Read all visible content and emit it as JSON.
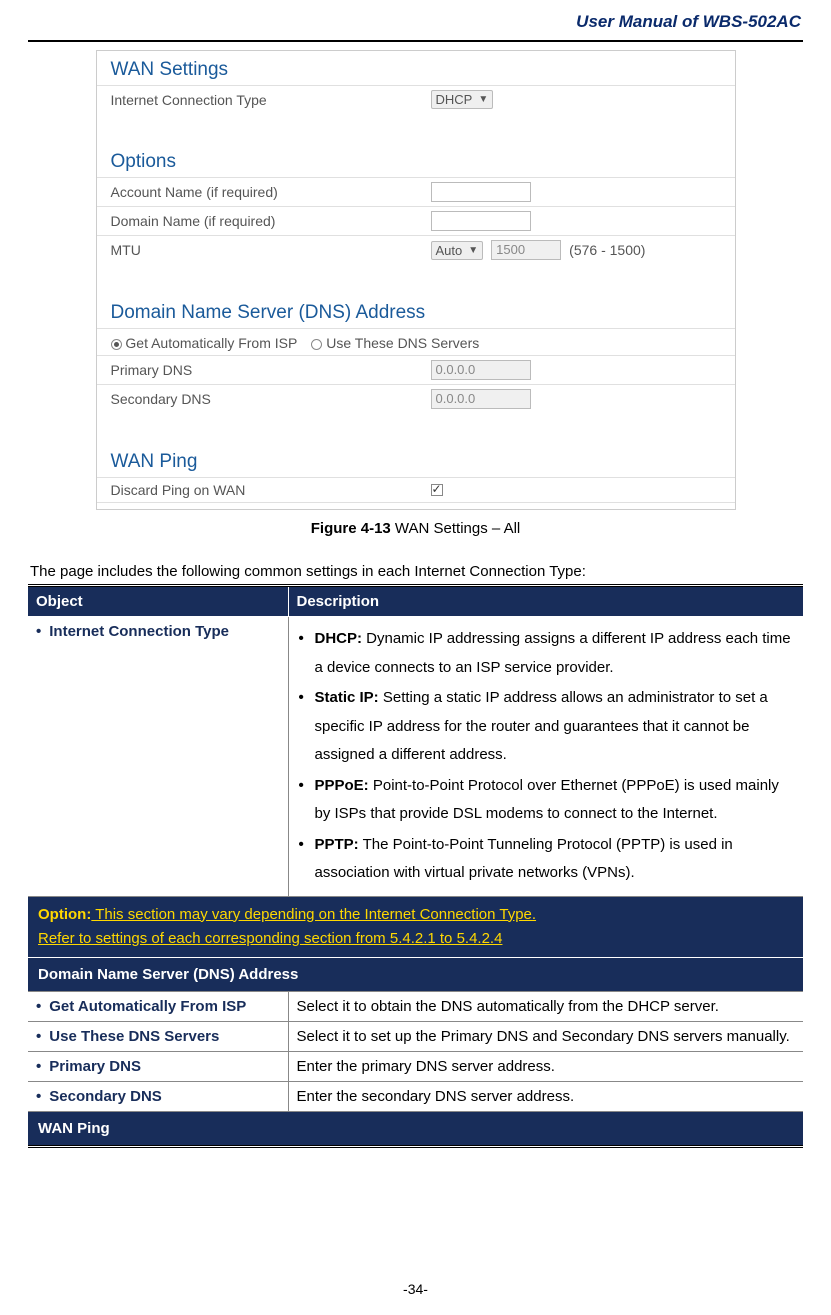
{
  "header": {
    "title": "User Manual of WBS-502AC"
  },
  "screenshot": {
    "wan_settings_title": "WAN Settings",
    "internet_conn_label": "Internet Connection Type",
    "internet_conn_value": "DHCP",
    "options_title": "Options",
    "account_name_label": "Account Name (if required)",
    "domain_name_label": "Domain Name (if required)",
    "mtu_label": "MTU",
    "mtu_mode": "Auto",
    "mtu_value": "1500",
    "mtu_range": "(576 - 1500)",
    "dns_title": "Domain Name Server (DNS) Address",
    "dns_radio_auto": "Get Automatically From ISP",
    "dns_radio_manual": "Use These DNS Servers",
    "primary_dns_label": "Primary DNS",
    "primary_dns_value": "0.0.0.0",
    "secondary_dns_label": "Secondary DNS",
    "secondary_dns_value": "0.0.0.0",
    "wan_ping_title": "WAN Ping",
    "discard_ping_label": "Discard Ping on WAN"
  },
  "caption": {
    "bold": "Figure 4-13",
    "rest": " WAN Settings – All"
  },
  "intro": "The page includes the following common settings in each Internet Connection Type:",
  "table": {
    "header_object": "Object",
    "header_desc": "Description",
    "row1_obj": "Internet Connection Type",
    "row1_dhcp_b": "DHCP:",
    "row1_dhcp": " Dynamic IP addressing assigns a different IP address each time a device connects to an ISP service provider.",
    "row1_static_b": "Static IP:",
    "row1_static": " Setting a static IP address allows an administrator to set a specific IP address for the router and guarantees that it cannot be assigned a different address.",
    "row1_pppoe_b": "PPPoE:",
    "row1_pppoe": " Point-to-Point Protocol over Ethernet (PPPoE) is used mainly by ISPs that provide DSL modems to connect to the Internet.",
    "row1_pptp_b": "PPTP:",
    "row1_pptp": " The Point-to-Point Tunneling Protocol (PPTP) is used in association with virtual private networks (VPNs).",
    "option_line1_b": "Option:",
    "option_line1": " This section may vary depending on the Internet Connection Type.",
    "option_line2": "Refer to settings of each corresponding section from 5.4.2.1 to 5.4.2.4",
    "subhead_dns": "Domain Name Server (DNS) Address",
    "row_auto_obj": "Get Automatically From ISP",
    "row_auto_desc": "Select it to obtain the DNS automatically from the DHCP server.",
    "row_manual_obj": "Use These DNS Servers",
    "row_manual_desc": "Select it to set up the Primary DNS and Secondary DNS servers manually.",
    "row_primary_obj": "Primary DNS",
    "row_primary_desc": "Enter the primary DNS server address.",
    "row_secondary_obj": "Secondary DNS",
    "row_secondary_desc": "Enter the secondary DNS server address.",
    "subhead_wanping": "WAN Ping"
  },
  "page_number": "-34-"
}
